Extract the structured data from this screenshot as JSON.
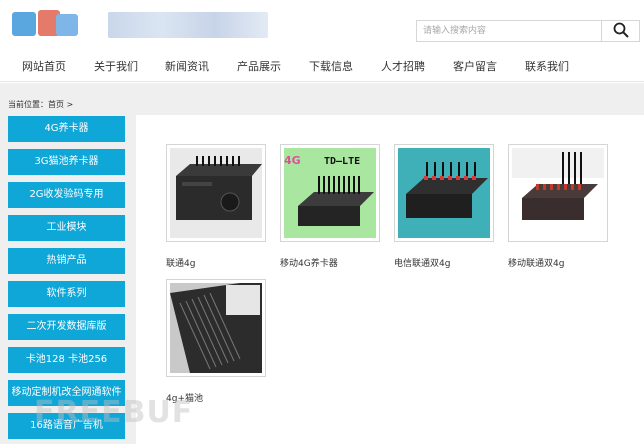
{
  "header": {
    "search": {
      "placeholder": "请输入搜索内容"
    }
  },
  "nav": {
    "items": [
      {
        "label": "网站首页"
      },
      {
        "label": "关于我们"
      },
      {
        "label": "新闻资讯"
      },
      {
        "label": "产品展示"
      },
      {
        "label": "下载信息"
      },
      {
        "label": "人才招聘"
      },
      {
        "label": "客户留言"
      },
      {
        "label": "联系我们"
      }
    ]
  },
  "breadcrumb": {
    "text": "当前位置：首页 >"
  },
  "sidebar": {
    "items": [
      {
        "label": "4G养卡器"
      },
      {
        "label": "3G猫池养卡器"
      },
      {
        "label": "2G收发验码专用"
      },
      {
        "label": "工业模块"
      },
      {
        "label": "热销产品"
      },
      {
        "label": "软件系列"
      },
      {
        "label": "二次开发数据库版"
      },
      {
        "label": "卡池128 卡池256"
      },
      {
        "label": "移动定制机改全网通软件"
      },
      {
        "label": "16路语音广告机"
      }
    ],
    "color": "#0fa6d8"
  },
  "products": [
    {
      "name": "联通4g",
      "image_text": ""
    },
    {
      "name": "移动4G养卡器",
      "image_text": "TD—LTE"
    },
    {
      "name": "电信联通双4g",
      "image_text": ""
    },
    {
      "name": "移动联通双4g",
      "image_text": ""
    },
    {
      "name": "4g+猫池",
      "image_text": ""
    }
  ],
  "watermark": {
    "text": "FREEBUF"
  },
  "icons": {
    "search": "search-icon"
  }
}
